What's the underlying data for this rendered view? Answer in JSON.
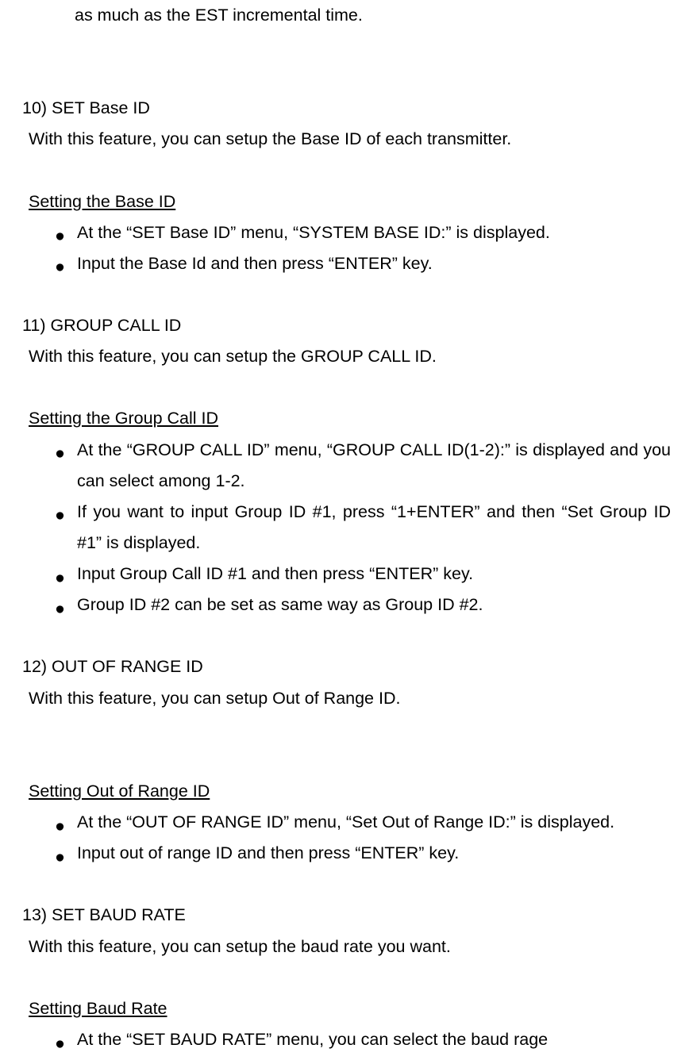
{
  "continuation_text": "as much as the EST incremental time.",
  "sections": [
    {
      "title": "10) SET Base ID",
      "intro": "With this feature, you can setup the Base ID of each transmitter.",
      "sub_heading": "Setting the Base ID",
      "bullets": [
        "At the “SET Base ID” menu, “SYSTEM BASE ID:” is displayed.",
        "Input the Base Id and then press “ENTER” key."
      ]
    },
    {
      "title": "11) GROUP CALL ID",
      "intro": "With this feature, you can setup the GROUP CALL ID.",
      "sub_heading": "Setting the Group Call ID",
      "bullets": [
        "At the “GROUP CALL ID” menu, “GROUP CALL ID(1-2):” is displayed and you can select among 1-2.",
        "If you want to input Group ID #1, press “1+ENTER” and then “Set Group ID #1” is displayed.",
        "Input Group Call ID #1 and then press “ENTER” key.",
        "Group ID #2 can be set as same way as Group ID #2."
      ]
    },
    {
      "title": "12) OUT OF RANGE ID",
      "intro": "With this feature, you can setup Out of Range ID.",
      "sub_heading_after_blank": true,
      "sub_heading": "Setting Out of Range ID",
      "bullets": [
        "At the “OUT OF RANGE ID” menu, “Set Out of Range ID:” is displayed.",
        "Input out of range ID and then press “ENTER” key."
      ]
    },
    {
      "title": "13) SET BAUD RATE",
      "intro": "With this feature, you can setup the baud rate you want.",
      "sub_heading": "Setting Baud Rate",
      "bullets": [
        "At the “SET BAUD RATE” menu, you can select the baud rage"
      ]
    }
  ],
  "justify_bullets": {
    "1": [
      0,
      1
    ],
    "2": [
      0
    ],
    "3": [
      0
    ]
  }
}
